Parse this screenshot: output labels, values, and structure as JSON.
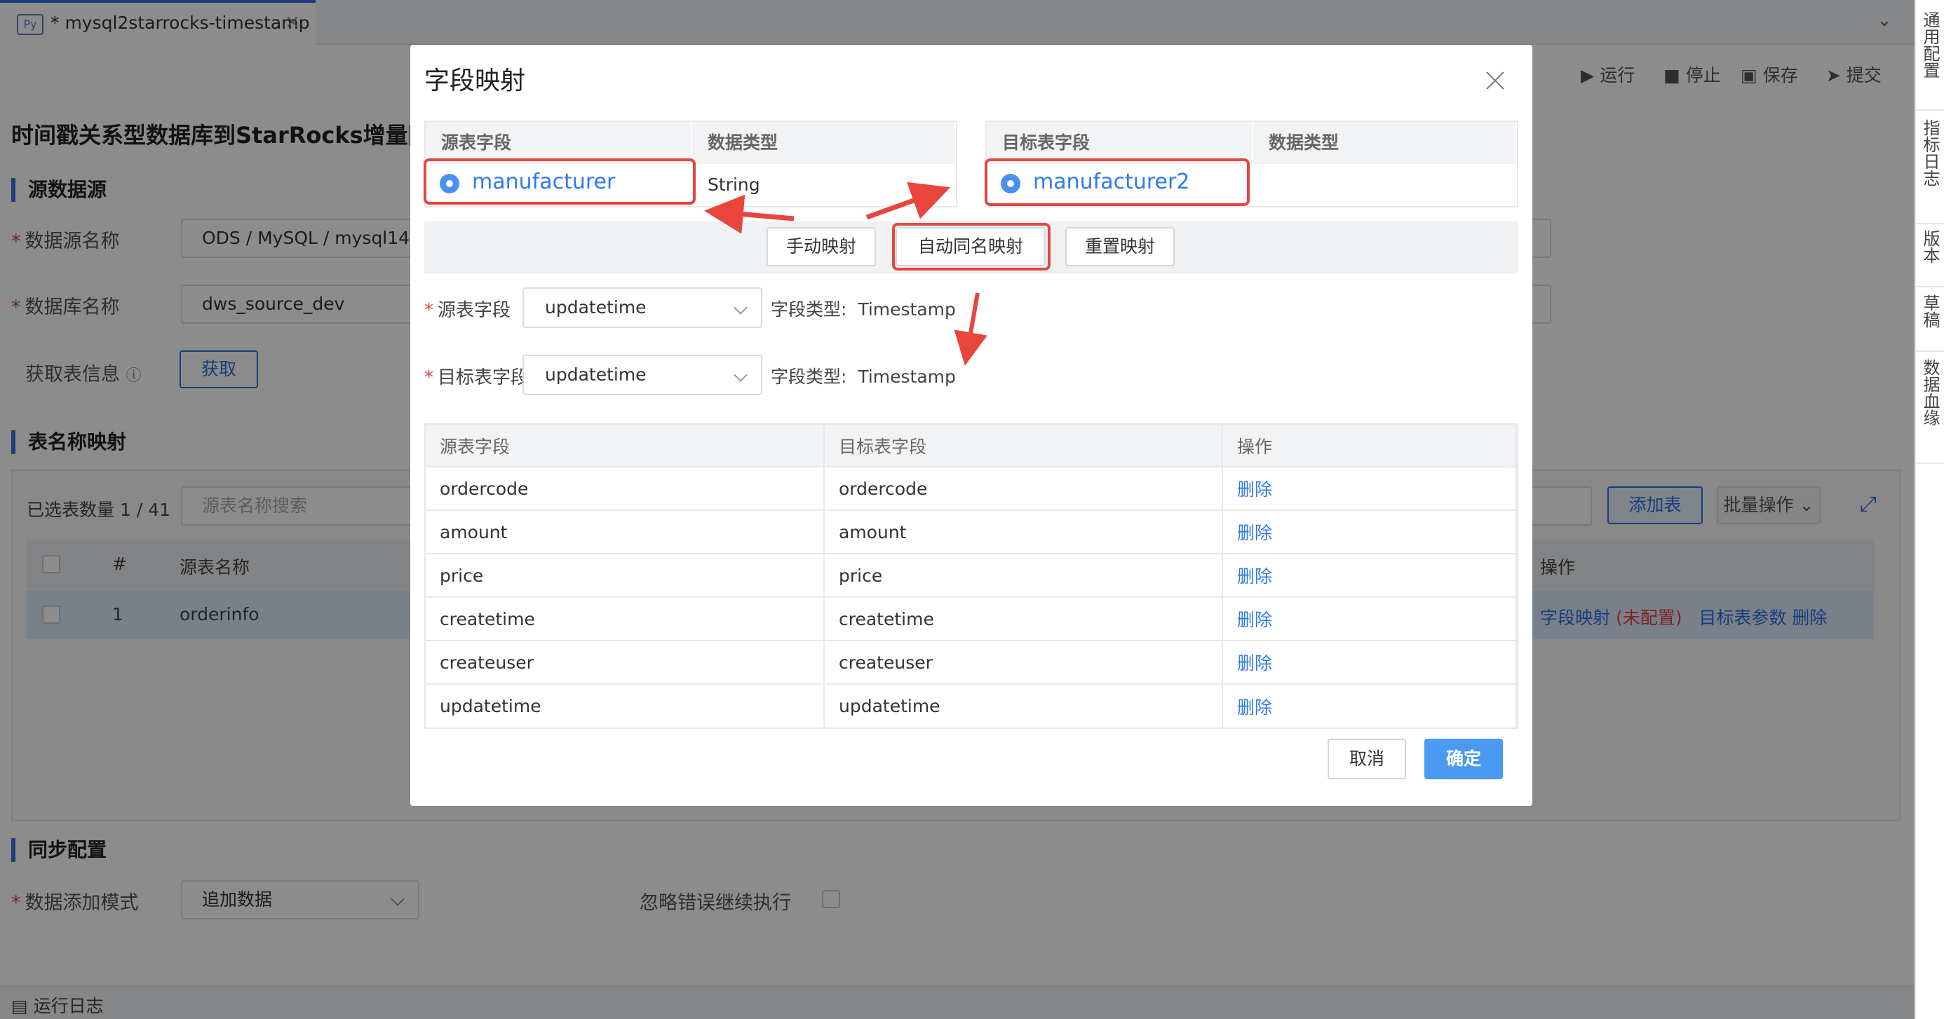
{
  "tab": {
    "icon": "py-file-icon",
    "title": "* mysql2starrocks-timestamp",
    "close": "×",
    "collapse": "⌄"
  },
  "toolbar": {
    "run": "运行",
    "stop": "停止",
    "save": "保存",
    "submit": "提交"
  },
  "page_title": "时间戳关系型数据库到StarRocks增量同",
  "sections": {
    "source": "源数据源",
    "table_map": "表名称映射",
    "sync": "同步配置"
  },
  "source_form": {
    "ds_name_label": "数据源名称",
    "ds_name_value": "ODS / MySQL / mysql142",
    "db_name_label": "数据库名称",
    "db_name_value": "dws_source_dev",
    "fetch_label": "获取表信息",
    "fetch_button": "获取"
  },
  "table_panel": {
    "selected_count": "已选表数量 1 / 41",
    "search_placeholder": "源表名称搜索",
    "add_table": "添加表",
    "batch_ops": "批量操作",
    "headers": {
      "index": "#",
      "source_name": "源表名称",
      "ops": "操作"
    },
    "row": {
      "index": "1",
      "name": "orderinfo",
      "field_map": "字段映射",
      "unconfigured": "(未配置)",
      "target_params": "目标表参数",
      "delete": "删除"
    }
  },
  "sync_form": {
    "mode_label": "数据添加模式",
    "mode_value": "追加数据",
    "ignore_label": "忽略错误继续执行"
  },
  "right_rail": [
    "通用配置",
    "指标日志",
    "版本",
    "草稿",
    "数据血缘"
  ],
  "bottom_bar": {
    "log": "运行日志"
  },
  "modal": {
    "title": "字段映射",
    "source_table": {
      "h1": "源表字段",
      "h2": "数据类型",
      "field": "manufacturer",
      "type": "String"
    },
    "target_table": {
      "h1": "目标表字段",
      "h2": "数据类型",
      "field": "manufacturer2",
      "type": ""
    },
    "buttons": {
      "manual": "手动映射",
      "auto": "自动同名映射",
      "reset": "重置映射"
    },
    "source_field_label": "源表字段",
    "source_field_value": "updatetime",
    "target_field_label": "目标表字段",
    "target_field_value": "updatetime",
    "type_label": "字段类型:",
    "source_type": "Timestamp",
    "target_type": "Timestamp",
    "map_headers": [
      "源表字段",
      "目标表字段",
      "操作"
    ],
    "map_rows": [
      {
        "src": "ordercode",
        "dst": "ordercode",
        "op": "删除"
      },
      {
        "src": "amount",
        "dst": "amount",
        "op": "删除"
      },
      {
        "src": "price",
        "dst": "price",
        "op": "删除"
      },
      {
        "src": "createtime",
        "dst": "createtime",
        "op": "删除"
      },
      {
        "src": "createuser",
        "dst": "createuser",
        "op": "删除"
      },
      {
        "src": "updatetime",
        "dst": "updatetime",
        "op": "删除"
      }
    ],
    "cancel": "取消",
    "ok": "确定"
  },
  "colors": {
    "accent": "#2f6fe0",
    "annotation": "#e8453c",
    "primary_button": "#4a9af2"
  }
}
